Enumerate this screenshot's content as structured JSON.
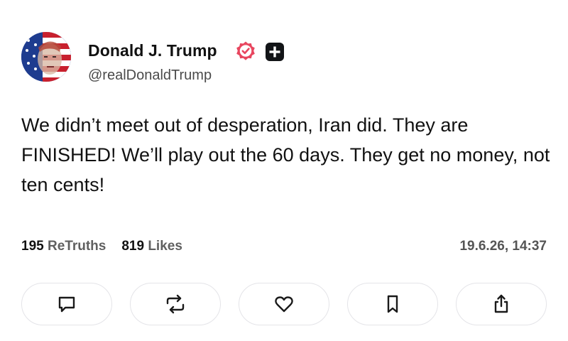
{
  "post": {
    "author": {
      "display_name": "Donald J. Trump",
      "handle": "@realDonaldTrump",
      "verified_icon": "verified-badge-icon",
      "plus_icon": "plus-badge-icon"
    },
    "text": "We didn’t meet out of desperation, Iran did. They are FINISHED! We’ll play out the 60 days. They get no money, not ten cents!",
    "stats": {
      "retruths_count": "195",
      "retruths_label": "ReTruths",
      "likes_count": "819",
      "likes_label": "Likes"
    },
    "timestamp": "19.6.26, 14:37"
  },
  "actions": [
    {
      "name": "reply",
      "icon": "comment-icon"
    },
    {
      "name": "retruth",
      "icon": "retruth-icon"
    },
    {
      "name": "like",
      "icon": "heart-icon"
    },
    {
      "name": "bookmark",
      "icon": "bookmark-icon"
    },
    {
      "name": "share",
      "icon": "share-icon"
    }
  ],
  "colors": {
    "verified": "#e8465f",
    "text": "#111111",
    "secondary": "#555555",
    "border": "#e4e4e8"
  }
}
